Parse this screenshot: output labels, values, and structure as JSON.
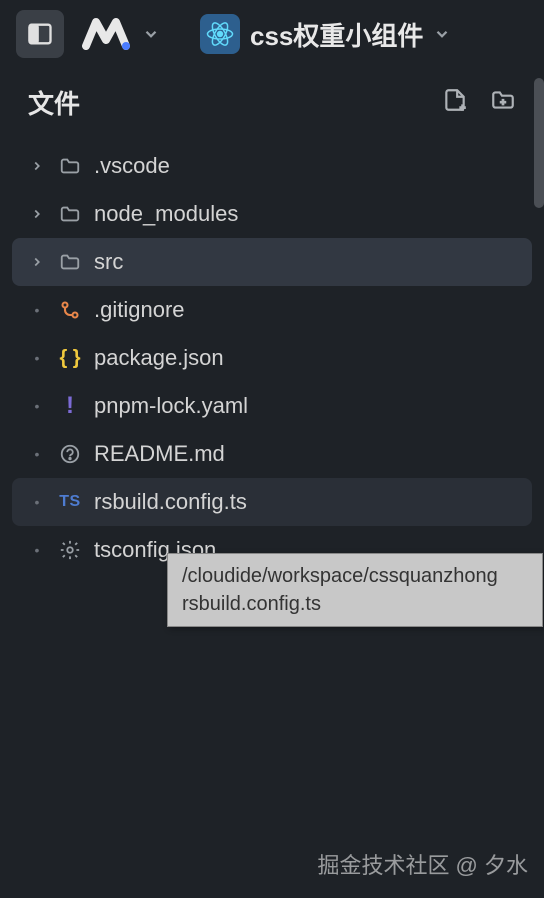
{
  "header": {
    "project_name": "css权重小组件"
  },
  "sidebar": {
    "section_title": "文件",
    "items": [
      {
        "label": ".vscode",
        "type": "folder",
        "expandable": true
      },
      {
        "label": "node_modules",
        "type": "folder",
        "expandable": true
      },
      {
        "label": "src",
        "type": "folder",
        "expandable": true,
        "selected": true
      },
      {
        "label": ".gitignore",
        "type": "git"
      },
      {
        "label": "package.json",
        "type": "json"
      },
      {
        "label": "pnpm-lock.yaml",
        "type": "yaml"
      },
      {
        "label": "README.md",
        "type": "readme"
      },
      {
        "label": "rsbuild.config.ts",
        "type": "ts",
        "hover": true
      },
      {
        "label": "tsconfig.json",
        "type": "gear"
      }
    ]
  },
  "tooltip": {
    "line1": "/cloudide/workspace/cssquanzhong",
    "line2": "rsbuild.config.ts"
  },
  "watermark": "掘金技术社区 @ 夕水"
}
